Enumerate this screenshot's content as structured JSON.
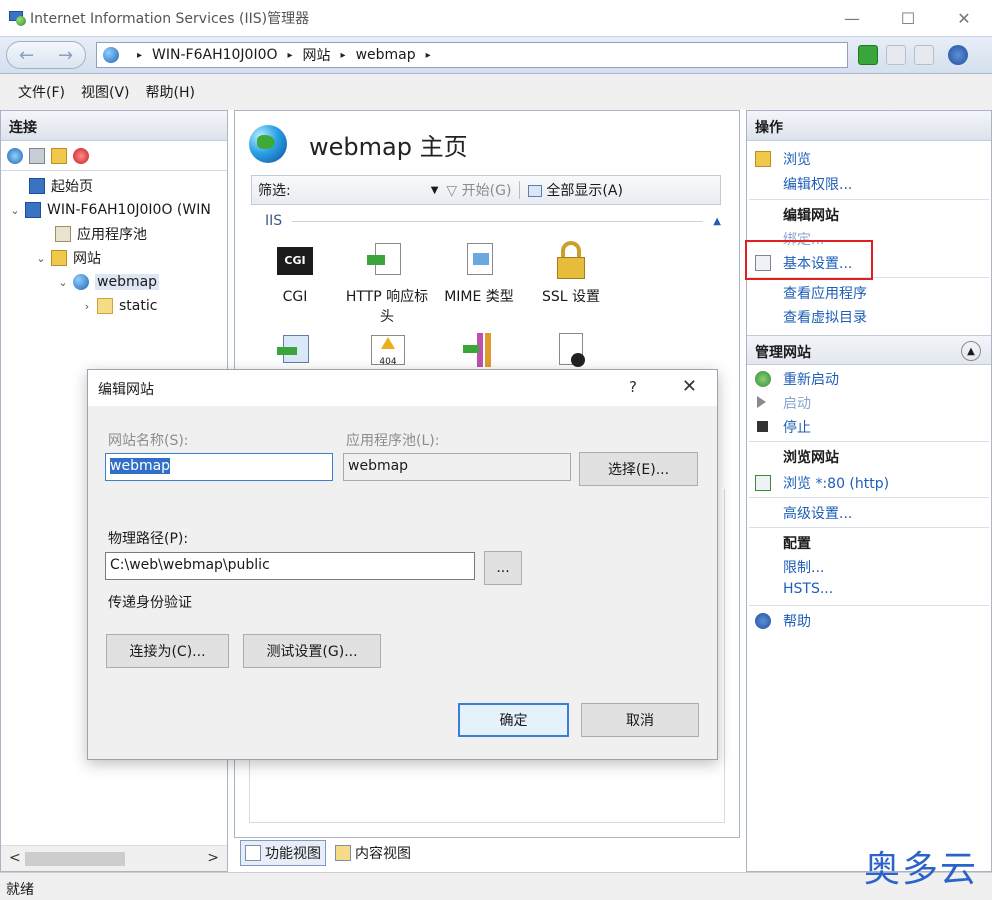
{
  "window": {
    "title": "Internet Information Services (IIS)管理器",
    "minimize": "—",
    "maximize": "☐",
    "close": "✕"
  },
  "address": {
    "back": "←",
    "forward": "→",
    "crumbs": [
      "WIN-F6AH10J0I0O",
      "网站",
      "webmap"
    ],
    "separator": "▸"
  },
  "menu": [
    "文件(F)",
    "视图(V)",
    "帮助(H)"
  ],
  "connections": {
    "header": "连接",
    "tree": [
      {
        "label": "起始页"
      },
      {
        "label": "WIN-F6AH10J0I0O (WIN"
      },
      {
        "label": "应用程序池"
      },
      {
        "label": "网站"
      },
      {
        "label": "webmap"
      },
      {
        "label": "static"
      }
    ],
    "scroll_left": "<",
    "scroll_right": ">"
  },
  "center": {
    "title": "webmap 主页",
    "filter_label": "筛选:",
    "start": "开始(G)",
    "show_all": "全部显示(A)",
    "group": "IIS",
    "features": [
      {
        "label": "CGI",
        "icon": "cgi-icon"
      },
      {
        "label": "HTTP 响应标头",
        "icon": "http-headers-icon"
      },
      {
        "label": "MIME 类型",
        "icon": "mime-icon"
      },
      {
        "label": "SSL 设置",
        "icon": "lock-icon"
      }
    ],
    "cgi_badge": "CGI",
    "error_badge": "404",
    "view_features": "功能视图",
    "view_content": "内容视图"
  },
  "actions": {
    "header": "操作",
    "browse": "浏览",
    "edit_permissions": "编辑权限...",
    "edit_site": "编辑网站",
    "bindings": "绑定...",
    "basic_settings": "基本设置...",
    "view_apps": "查看应用程序",
    "view_vdirs": "查看虚拟目录",
    "manage_site": "管理网站",
    "restart": "重新启动",
    "start": "启动",
    "stop": "停止",
    "browse_site": "浏览网站",
    "browse_80": "浏览 *:80 (http)",
    "advanced": "高级设置...",
    "config": "配置",
    "limits": "限制...",
    "hsts": "HSTS...",
    "help": "帮助"
  },
  "dialog": {
    "title": "编辑网站",
    "help": "?",
    "close": "✕",
    "site_name_label": "网站名称(S):",
    "site_name": "webmap",
    "app_pool_label": "应用程序池(L):",
    "app_pool": "webmap",
    "select": "选择(E)...",
    "path_label": "物理路径(P):",
    "path": "C:\\web\\webmap\\public",
    "browse": "...",
    "auth_label": "传递身份验证",
    "connect_as": "连接为(C)...",
    "test": "测试设置(G)...",
    "ok": "确定",
    "cancel": "取消"
  },
  "status": "就绪",
  "watermark": "奥多云",
  "colors": {
    "accent": "#1e5eb8",
    "highlight": "#e02020"
  }
}
